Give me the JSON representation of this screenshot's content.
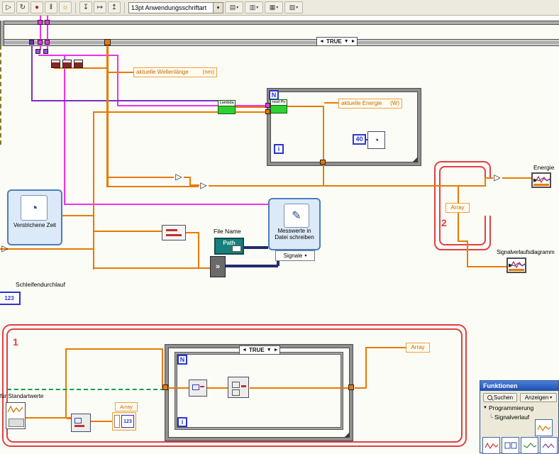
{
  "toolbar": {
    "font_selector": "13pt Anwendungsschriftart"
  },
  "icons": {
    "run": "▷",
    "run_continuous": "↻",
    "abort": "●",
    "pause": "‖",
    "highlight_execution": "☼",
    "step_into": "↧",
    "step_over": "↦",
    "step_out": "↥",
    "align_objects": "▤",
    "distribute_objects": "▥",
    "resize_objects": "▦",
    "reorder": "▧",
    "dropdown": "▾",
    "case_prev": "◄",
    "case_next": "►",
    "case_down": "▼",
    "triangle_node": "▷",
    "clock": "◔",
    "pencil": "✎",
    "merge": "»",
    "tree_collapse": "▼",
    "tree_branch": "└"
  },
  "colors": {
    "wire_orange": "#e87a00",
    "wire_pink": "#ef30ef",
    "wire_violet": "#7b2fbe",
    "wire_blue": "#2936cc",
    "wire_navy": "#232a6e",
    "wire_green": "#00a33d",
    "frame_red": "#e04040",
    "terminal_green": "#2fd12f",
    "express_bg": "#dce9f8",
    "express_border": "#4a7ebb",
    "label_border": "#f0a040",
    "label_text": "#c46a00"
  },
  "diagram": {
    "case_selector": "TRUE",
    "inner_case_selector": "TRUE",
    "labels": {
      "wellenlaenge_text": "aktuelle Wellenlänge",
      "wellenlaenge_unit": "(nm)",
      "energie_text": "aktuelle Energie",
      "energie_unit": "(W)",
      "file_name": "File Name",
      "schleifendurchlauf": "Schleifendurchlauf",
      "standartwerte": "für Standartwerte",
      "energie_terminal": "Energie",
      "signalverlaufsdiagramm": "Signalverlaufsdiagramm",
      "array": "Array",
      "frame1_number": "1",
      "frame2_number": "2"
    },
    "terminals": {
      "loop_count": "N",
      "iteration": "i",
      "lambda": "Lambda",
      "rssd_po": "rssd Po",
      "numeric_123": "123",
      "wait_ms": "40",
      "path": "Path"
    },
    "express_vis": {
      "elapsed_time_title": "Verstrichene Zeit",
      "write_file_title": "Messwerte in Datei schreiben",
      "write_file_signal_tab": "Signale"
    }
  },
  "palette": {
    "title": "Funktionen",
    "search_button": "Suchen",
    "view_button": "Anzeigen",
    "category": "Programmierung",
    "subcategory": "Signalverlauf"
  }
}
